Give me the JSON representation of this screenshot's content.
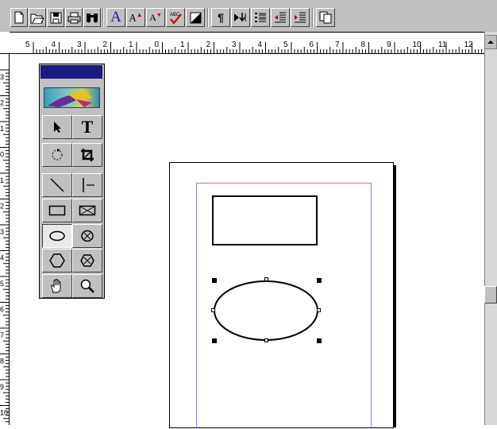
{
  "toolbar": {
    "buttons": [
      {
        "name": "new-document",
        "icon": "new-document-icon"
      },
      {
        "name": "open",
        "icon": "open-folder-icon"
      },
      {
        "name": "save",
        "icon": "save-disk-icon"
      },
      {
        "name": "print",
        "icon": "printer-icon"
      },
      {
        "name": "find",
        "icon": "binoculars-icon"
      },
      {
        "name": "font",
        "icon": "font-A-icon",
        "label": "A"
      },
      {
        "name": "increase-font-size",
        "icon": "font-increase-icon",
        "label": "A"
      },
      {
        "name": "decrease-font-size",
        "icon": "font-decrease-icon",
        "label": "A"
      },
      {
        "name": "spell-check",
        "icon": "spell-check-icon",
        "label": "ABC"
      },
      {
        "name": "fill-color",
        "icon": "fill-color-icon"
      },
      {
        "name": "paragraph",
        "icon": "pilcrow-icon",
        "label": "¶"
      },
      {
        "name": "insert-special",
        "icon": "insert-arrow-icon"
      },
      {
        "name": "bullets",
        "icon": "bullet-list-icon"
      },
      {
        "name": "decrease-indent",
        "icon": "decrease-indent-icon"
      },
      {
        "name": "increase-indent",
        "icon": "increase-indent-icon"
      },
      {
        "name": "copy",
        "icon": "copy-icon"
      }
    ]
  },
  "horizontal_ruler": {
    "labels": [
      "5",
      "4",
      "3",
      "2",
      "1",
      "0",
      "1",
      "2",
      "3",
      "4",
      "5",
      "6",
      "7",
      "8",
      "9",
      "10",
      "11",
      "12"
    ]
  },
  "vertical_ruler": {
    "labels": [
      "3",
      "2",
      "1",
      "0",
      "1",
      "2",
      "3",
      "4",
      "5",
      "6",
      "7",
      "8",
      "9",
      "10"
    ]
  },
  "toolbox": {
    "tools": [
      {
        "name": "pointer-tool",
        "icon": "arrow-pointer-icon"
      },
      {
        "name": "text-tool",
        "icon": "text-T-icon",
        "label": "T"
      },
      {
        "name": "rotate-tool",
        "icon": "rotate-icon"
      },
      {
        "name": "crop-tool",
        "icon": "crop-icon"
      },
      {
        "name": "line-tool",
        "icon": "diagonal-line-icon"
      },
      {
        "name": "orthogonal-line-tool",
        "icon": "orthogonal-line-icon"
      },
      {
        "name": "rectangle-tool",
        "icon": "rectangle-icon"
      },
      {
        "name": "rectangle-frame-tool",
        "icon": "rectangle-frame-icon"
      },
      {
        "name": "ellipse-tool",
        "icon": "ellipse-icon",
        "selected": true
      },
      {
        "name": "ellipse-frame-tool",
        "icon": "ellipse-frame-icon"
      },
      {
        "name": "polygon-tool",
        "icon": "hexagon-icon"
      },
      {
        "name": "polygon-frame-tool",
        "icon": "hexagon-frame-icon"
      },
      {
        "name": "hand-tool",
        "icon": "hand-icon"
      },
      {
        "name": "zoom-tool",
        "icon": "magnifier-icon"
      }
    ]
  },
  "colors": {
    "chrome": "#c0c0c0",
    "toolbox_title": "#1a1a80",
    "margin_guide_top": "#e060c0",
    "margin_guide_side": "#8080ff",
    "font_button_blue": "#1a1ab0"
  }
}
